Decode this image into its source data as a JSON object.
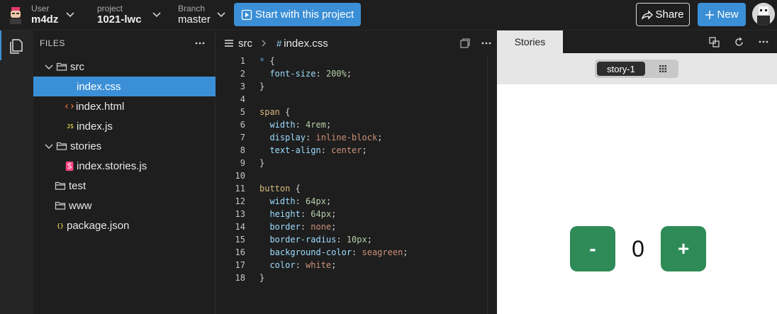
{
  "topbar": {
    "user_label": "User",
    "user_value": "m4dz",
    "project_label": "project",
    "project_value": "1021-lwc",
    "branch_label": "Branch",
    "branch_value": "master",
    "start_button": "Start with this project",
    "share_button": "Share",
    "new_button": "New"
  },
  "explorer": {
    "header": "FILES",
    "items": [
      {
        "label": "src",
        "type": "folder-open"
      },
      {
        "label": "index.css",
        "type": "css",
        "selected": true
      },
      {
        "label": "index.html",
        "type": "html"
      },
      {
        "label": "index.js",
        "type": "js",
        "icon_text": "JS"
      },
      {
        "label": "stories",
        "type": "folder-open"
      },
      {
        "label": "index.stories.js",
        "type": "storybook"
      },
      {
        "label": "test",
        "type": "folder"
      },
      {
        "label": "www",
        "type": "folder"
      },
      {
        "label": "package.json",
        "type": "json",
        "icon_text": "{}"
      }
    ]
  },
  "editor": {
    "breadcrumb_folder": "src",
    "breadcrumb_file": "index.css",
    "hash_glyph": "#",
    "lines": [
      {
        "n": "1",
        "html": "<span class=\"c-star\">*</span> {"
      },
      {
        "n": "2",
        "html": "  <span class=\"c-prop\">font-size</span>: <span class=\"c-num\">200%</span>;"
      },
      {
        "n": "3",
        "html": "}"
      },
      {
        "n": "4",
        "html": ""
      },
      {
        "n": "5",
        "html": "<span class=\"c-sel\">span</span> {"
      },
      {
        "n": "6",
        "html": "  <span class=\"c-prop\">width</span>: <span class=\"c-num\">4rem</span>;"
      },
      {
        "n": "7",
        "html": "  <span class=\"c-prop\">display</span>: <span class=\"c-val\">inline-block</span>;"
      },
      {
        "n": "8",
        "html": "  <span class=\"c-prop\">text-align</span>: <span class=\"c-val\">center</span>;"
      },
      {
        "n": "9",
        "html": "}"
      },
      {
        "n": "10",
        "html": ""
      },
      {
        "n": "11",
        "html": "<span class=\"c-sel\">button</span> {"
      },
      {
        "n": "12",
        "html": "  <span class=\"c-prop\">width</span>: <span class=\"c-num\">64px</span>;"
      },
      {
        "n": "13",
        "html": "  <span class=\"c-prop\">height</span>: <span class=\"c-num\">64px</span>;"
      },
      {
        "n": "14",
        "html": "  <span class=\"c-prop\">border</span>: <span class=\"c-val\">none</span>;"
      },
      {
        "n": "15",
        "html": "  <span class=\"c-prop\">border-radius</span>: <span class=\"c-num\">10px</span>;"
      },
      {
        "n": "16",
        "html": "  <span class=\"c-prop\">background-color</span>: <span class=\"c-val\">seagreen</span>;"
      },
      {
        "n": "17",
        "html": "  <span class=\"c-prop\">color</span>: <span class=\"c-val\">white</span>;"
      },
      {
        "n": "18",
        "html": "}"
      }
    ]
  },
  "stories": {
    "tab": "Stories",
    "story_tab": "story-1",
    "decrement": "-",
    "count": "0",
    "increment": "+"
  },
  "colors": {
    "accent": "#3b8fd6",
    "seagreen": "#2e8b57",
    "storybook": "#ff4785"
  }
}
